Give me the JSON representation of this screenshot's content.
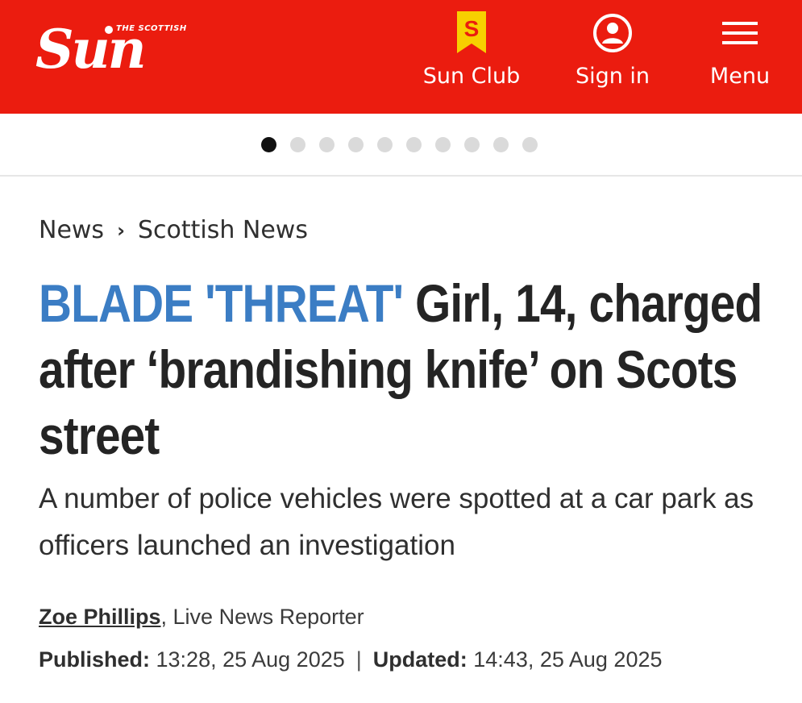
{
  "header": {
    "logo_tag": "THE SCOTTISH",
    "logo_word": "Sun",
    "brand_color": "#eb1c0f",
    "nav": {
      "sun_club": {
        "label": "Sun Club",
        "icon": "sun-club-badge-icon",
        "badge_letter": "S"
      },
      "sign_in": {
        "label": "Sign in",
        "icon": "user-icon"
      },
      "menu": {
        "label": "Menu",
        "icon": "hamburger-icon"
      }
    }
  },
  "carousel": {
    "dot_count": 10,
    "active_index": 0
  },
  "breadcrumb": {
    "items": [
      "News",
      "Scottish News"
    ],
    "separator": "›"
  },
  "article": {
    "kicker": "BLADE 'THREAT'",
    "kicker_color": "#3b7dc4",
    "headline": " Girl, 14, charged after ‘brandishing knife’ on Scots street",
    "standfirst": "A number of police vehicles were spotted at a car park as officers launched an investigation",
    "author": "Zoe Phillips",
    "author_role": ", Live News Reporter",
    "published_label": "Published:",
    "published_value": " 13:28, 25 Aug 2025",
    "separator": "|",
    "updated_label": "Updated:",
    "updated_value": " 14:43, 25 Aug 2025"
  }
}
